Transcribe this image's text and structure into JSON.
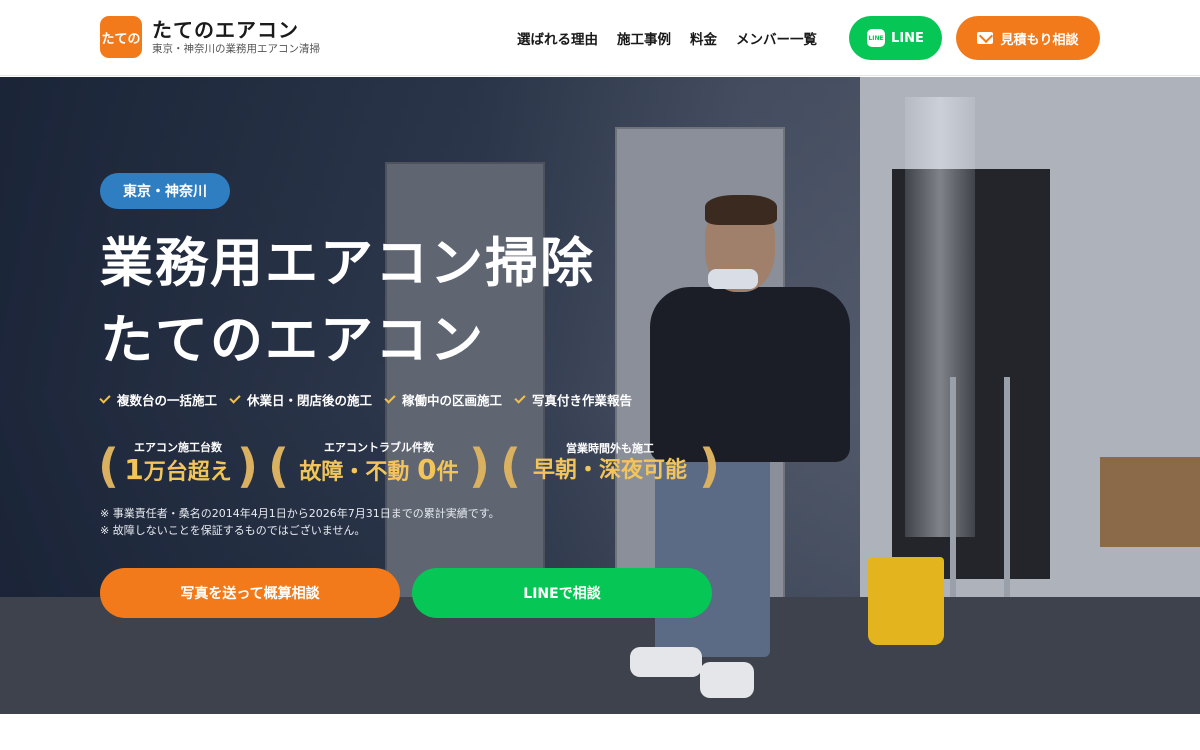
{
  "header": {
    "logo_mark": "たての",
    "logo_name": "たてのエアコン",
    "logo_sub": "東京・神奈川の業務用エアコン清掃",
    "nav": [
      "選ばれる理由",
      "施工事例",
      "料金",
      "メンバー一覧"
    ],
    "line_button": "LINE",
    "line_icon_text": "LINE",
    "quote_button": "見積もり相談"
  },
  "hero": {
    "area_badge": "東京・神奈川",
    "title_line1": "業務用エアコン掃除",
    "title_line2": "たてのエアコン",
    "features": [
      "複数台の一括施工",
      "休業日・閉店後の施工",
      "稼働中の区画施工",
      "写真付き作業報告"
    ],
    "stats": [
      {
        "label": "エアコン施工台数",
        "value_big": "1",
        "value_rest": "万台超え"
      },
      {
        "label": "エアコントラブル件数",
        "value_pre": "故障・不動 ",
        "value_big": "0",
        "value_rest": "件"
      },
      {
        "label": "営業時間外も施工",
        "value_pre": "早朝・深夜可能"
      }
    ],
    "notes": [
      "※ 事業責任者・桑名の2014年4月1日から2026年7月31日までの累計実績です。",
      "※ 故障しないことを保証するものではございません。"
    ],
    "cta_photo": "写真を送って概算相談",
    "cta_line": "LINEで相談"
  },
  "colors": {
    "accent_orange": "#f27a1a",
    "line_green": "#06c755",
    "badge_blue": "#2f7ec1",
    "gold": "#f3c45a"
  },
  "icons": [
    "line-icon",
    "mail-icon",
    "check-icon",
    "laurel-icon"
  ]
}
